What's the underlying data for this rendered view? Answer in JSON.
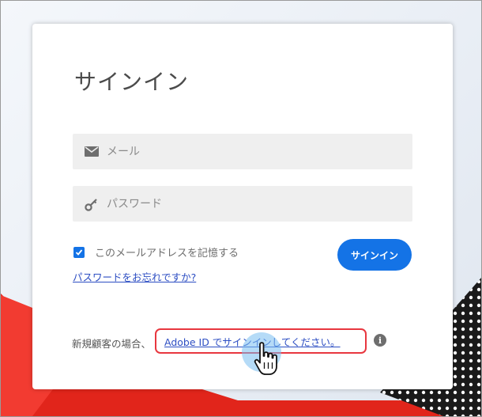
{
  "login": {
    "title": "サインイン",
    "email_placeholder": "メール",
    "password_placeholder": "パスワード",
    "remember_label": "このメールアドレスを記憶する",
    "remember_checked": true,
    "signin_button": "サインイン",
    "forgot_link": "パスワードをお忘れですか?",
    "new_customer_text": "新規顧客の場合、",
    "adobe_id_link": "Adobe ID でサインインしてください。",
    "info_icon": "info-icon"
  },
  "colors": {
    "accent": "#1473e6",
    "link": "#2d4ec3",
    "highlight_border": "#e8373f",
    "background_red": "#e1251b"
  }
}
